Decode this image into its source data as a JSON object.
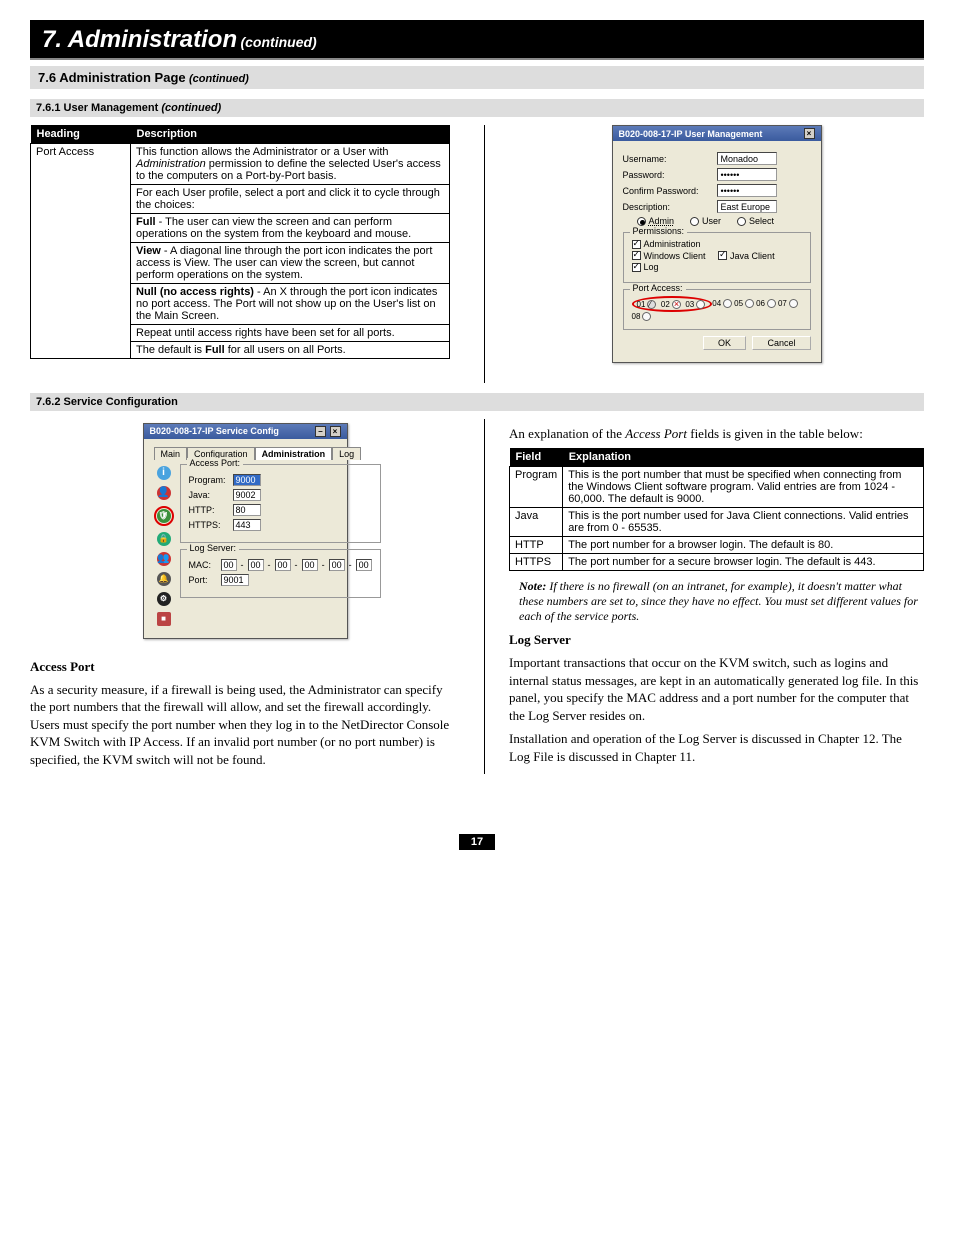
{
  "chapter": {
    "number_title": "7. Administration",
    "continued": "(continued)"
  },
  "section": {
    "title": "7.6 Administration Page",
    "continued": "(continued)"
  },
  "subsection1": {
    "title": "7.6.1 User Management",
    "continued": "(continued)"
  },
  "subsection2": {
    "title": "7.6.2 Service Configuration"
  },
  "port_access_table": {
    "headers": [
      "Heading",
      "Description"
    ],
    "heading": "Port Access",
    "rows": [
      "This function allows the Administrator or a User with Administration permission to define the selected User's access to the computers on a Port-by-Port basis.",
      "For each User profile, select a port and click it to cycle through the choices:",
      "Full - The user can view the screen and can perform operations on the system from the keyboard and mouse.",
      "View - A diagonal line through the port icon indicates the port access is View. The user can view the screen, but cannot perform operations on the system.",
      "Null (no access rights) - An X through the port icon indicates no port access. The Port will not show up on the User's list on the Main Screen.",
      "Repeat until access rights have been set for all ports.",
      "The default is Full for all users on all Ports."
    ]
  },
  "user_mgmt_fig": {
    "title": "B020-008-17-IP User Management",
    "username_lbl": "Username:",
    "username_val": "Monadoo",
    "password_lbl": "Password:",
    "password_val": "••••••",
    "confirm_lbl": "Confirm Password:",
    "confirm_val": "••••••",
    "desc_lbl": "Description:",
    "desc_val": "East Europe",
    "role_admin": "Admin",
    "role_user": "User",
    "role_select": "Select",
    "perm_legend": "Permissions:",
    "perm_admin": "Administration",
    "perm_win": "Windows Client",
    "perm_java": "Java Client",
    "perm_log": "Log",
    "portaccess_legend": "Port Access:",
    "ports": [
      "01",
      "02",
      "03",
      "04",
      "05",
      "06",
      "07",
      "08"
    ],
    "ok": "OK",
    "cancel": "Cancel"
  },
  "svc_fig": {
    "title": "B020-008-17-IP Service Config",
    "tabs": [
      "Main",
      "Configuration",
      "Administration",
      "Log"
    ],
    "access_port_legend": "Access Port:",
    "program_lbl": "Program:",
    "program_val": "9000",
    "java_lbl": "Java:",
    "java_val": "9002",
    "http_lbl": "HTTP:",
    "http_val": "80",
    "https_lbl": "HTTPS:",
    "https_val": "443",
    "logserver_legend": "Log Server:",
    "mac_lbl": "MAC:",
    "mac_val": [
      "00",
      "00",
      "00",
      "00",
      "00",
      "00"
    ],
    "port_lbl": "Port:",
    "port_val": "9001"
  },
  "access_port_prose": {
    "hdr": "Access Port",
    "p1": "As a security measure, if a firewall is being used, the Administrator can specify the port numbers that the firewall will allow, and set the firewall accordingly. Users must specify the port number when they log in to the NetDirector Console KVM Switch with IP Access. If an invalid port number (or no port number) is specified, the KVM switch will not be found."
  },
  "field_table_intro": "An explanation of the Access Port fields is given in the table below:",
  "field_table": {
    "headers": [
      "Field",
      "Explanation"
    ],
    "rows": [
      [
        "Program",
        "This is the port number that must be specified when connecting from the Windows Client software program. Valid entries are from 1024 - 60,000. The default is 9000."
      ],
      [
        "Java",
        "This is the port number used for Java Client connections. Valid entries are from 0 - 65535."
      ],
      [
        "HTTP",
        "The port number for a browser login. The default is 80."
      ],
      [
        "HTTPS",
        "The port number for a secure browser login. The default is 443."
      ]
    ]
  },
  "note": "If there is no firewall (on an intranet, for example), it doesn't matter what these numbers are set to, since they have no effect. You must set different values for each of the service ports.",
  "note_prefix": "Note:",
  "log_server": {
    "hdr": "Log Server",
    "p1": "Important transactions that occur on the KVM switch, such as logins and internal status messages, are kept in an automatically generated log file. In this panel, you specify the MAC address and a port number for the computer that the Log Server resides on.",
    "p2": "Installation and operation of the Log Server is discussed in Chapter 12. The Log File is discussed in Chapter 11."
  },
  "page_number": "17"
}
